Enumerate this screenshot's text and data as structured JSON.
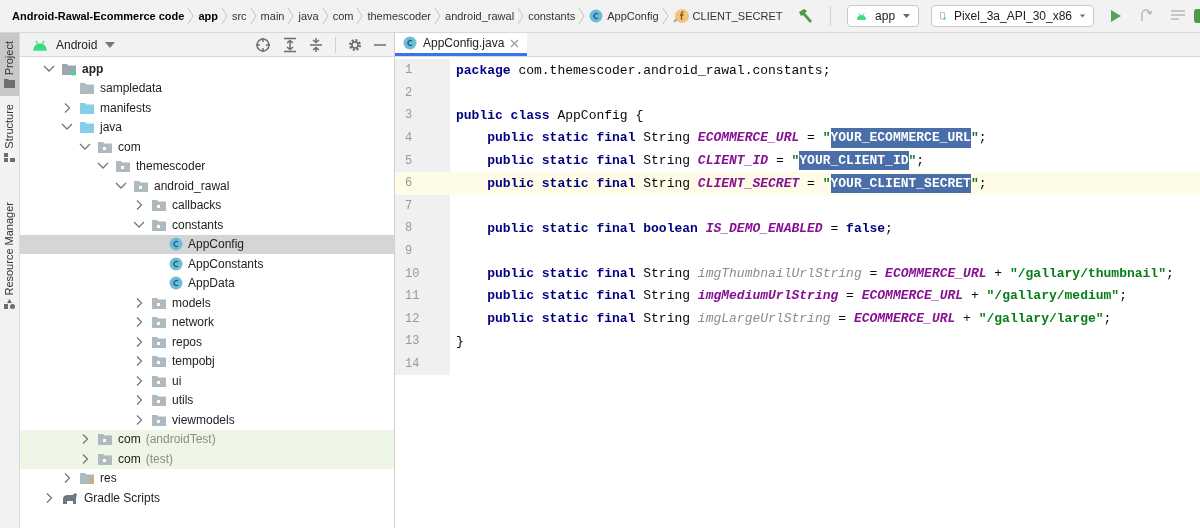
{
  "breadcrumbs": [
    {
      "label": "Android-Rawal-Ecommerce code",
      "kind": "project"
    },
    {
      "label": "app",
      "kind": "module"
    },
    {
      "label": "src",
      "kind": "folder"
    },
    {
      "label": "main",
      "kind": "folder"
    },
    {
      "label": "java",
      "kind": "folder"
    },
    {
      "label": "com",
      "kind": "folder"
    },
    {
      "label": "themescoder",
      "kind": "folder"
    },
    {
      "label": "android_rawal",
      "kind": "folder"
    },
    {
      "label": "constants",
      "kind": "folder"
    },
    {
      "label": "AppConfig",
      "kind": "class"
    },
    {
      "label": "CLIENT_SECRET",
      "kind": "field"
    }
  ],
  "run_config": {
    "module": "app",
    "device": "Pixel_3a_API_30_x86"
  },
  "tool_strip": [
    {
      "label": "Project",
      "selected": true
    },
    {
      "label": "Structure",
      "selected": false
    },
    {
      "label": "Resource Manager",
      "selected": false
    }
  ],
  "project_panel": {
    "view": "Android",
    "tree": [
      {
        "label": "app",
        "kind": "module",
        "expanded": true,
        "selected": false,
        "children": [
          {
            "label": "sampledata",
            "kind": "plain_folder",
            "selected": false
          },
          {
            "label": "manifests",
            "kind": "source_folder",
            "expanded": false,
            "selected": false
          },
          {
            "label": "java",
            "kind": "source_folder",
            "expanded": true,
            "selected": false,
            "children": [
              {
                "label": "com",
                "kind": "package",
                "expanded": true,
                "selected": false,
                "children": [
                  {
                    "label": "themescoder",
                    "kind": "package",
                    "expanded": true,
                    "selected": false,
                    "children": [
                      {
                        "label": "android_rawal",
                        "kind": "package",
                        "expanded": true,
                        "selected": false,
                        "children": [
                          {
                            "label": "callbacks",
                            "kind": "package",
                            "expanded": false,
                            "selected": false
                          },
                          {
                            "label": "constants",
                            "kind": "package",
                            "expanded": true,
                            "selected": false,
                            "children": [
                              {
                                "label": "AppConfig",
                                "kind": "class",
                                "selected": true
                              },
                              {
                                "label": "AppConstants",
                                "kind": "class",
                                "selected": false
                              },
                              {
                                "label": "AppData",
                                "kind": "class",
                                "selected": false
                              }
                            ]
                          },
                          {
                            "label": "models",
                            "kind": "package",
                            "expanded": false,
                            "selected": false
                          },
                          {
                            "label": "network",
                            "kind": "package",
                            "expanded": false,
                            "selected": false
                          },
                          {
                            "label": "repos",
                            "kind": "package",
                            "expanded": false,
                            "selected": false
                          },
                          {
                            "label": "tempobj",
                            "kind": "package",
                            "expanded": false,
                            "selected": false
                          },
                          {
                            "label": "ui",
                            "kind": "package",
                            "expanded": false,
                            "selected": false
                          },
                          {
                            "label": "utils",
                            "kind": "package",
                            "expanded": false,
                            "selected": false
                          },
                          {
                            "label": "viewmodels",
                            "kind": "package",
                            "expanded": false,
                            "selected": false
                          }
                        ]
                      }
                    ]
                  }
                ]
              },
              {
                "label": "com",
                "suffix": "(androidTest)",
                "kind": "test_package",
                "expanded": false,
                "selected": false
              },
              {
                "label": "com",
                "suffix": "(test)",
                "kind": "test_package",
                "expanded": false,
                "selected": false
              }
            ]
          },
          {
            "label": "res",
            "kind": "res_folder",
            "expanded": false,
            "selected": false
          }
        ]
      },
      {
        "label": "Gradle Scripts",
        "kind": "gradle",
        "expanded": false,
        "selected": false
      }
    ]
  },
  "editor": {
    "tabs": [
      {
        "label": "AppConfig.java",
        "selected": true
      }
    ],
    "lines": [
      {
        "number": "1",
        "current": false,
        "tokens": [
          {
            "kind": "kw",
            "text": "package"
          },
          {
            "kind": "txt",
            "text": " com.themescoder.android_rawal.constants;"
          }
        ]
      },
      {
        "number": "2",
        "current": false
      },
      {
        "number": "3",
        "current": false,
        "tokens": [
          {
            "kind": "kw",
            "text": "public class"
          },
          {
            "kind": "txt",
            "text": " AppConfig {"
          }
        ]
      },
      {
        "number": "4",
        "current": false,
        "tokens": [
          {
            "kind": "kw",
            "text": "    public static final"
          },
          {
            "kind": "txt",
            "text": " String "
          },
          {
            "kind": "const",
            "text": "ECOMMERCE_URL"
          },
          {
            "kind": "txt",
            "text": " = "
          },
          {
            "kind": "str",
            "text": "\""
          },
          {
            "kind": "sel",
            "text": "YOUR_ECOMMERCE_URL"
          },
          {
            "kind": "str",
            "text": "\""
          },
          {
            "kind": "txt",
            "text": ";"
          }
        ]
      },
      {
        "number": "5",
        "current": false,
        "tokens": [
          {
            "kind": "kw",
            "text": "    public static final"
          },
          {
            "kind": "txt",
            "text": " String "
          },
          {
            "kind": "const",
            "text": "CLIENT_ID"
          },
          {
            "kind": "txt",
            "text": " = "
          },
          {
            "kind": "str",
            "text": "\""
          },
          {
            "kind": "sel",
            "text": "YOUR_CLIENT_ID"
          },
          {
            "kind": "str",
            "text": "\""
          },
          {
            "kind": "txt",
            "text": ";"
          }
        ]
      },
      {
        "number": "6",
        "current": true,
        "tokens": [
          {
            "kind": "kw",
            "text": "    public static final"
          },
          {
            "kind": "txt",
            "text": " String "
          },
          {
            "kind": "const",
            "text": "CLIENT_SECRET"
          },
          {
            "kind": "txt",
            "text": " = "
          },
          {
            "kind": "str",
            "text": "\""
          },
          {
            "kind": "sel",
            "text": "YOUR_CLIENT_SECRET"
          },
          {
            "kind": "str",
            "text": "\""
          },
          {
            "kind": "txt",
            "text": ";"
          }
        ]
      },
      {
        "number": "7",
        "current": false
      },
      {
        "number": "8",
        "current": false,
        "tokens": [
          {
            "kind": "kw",
            "text": "    public static final boolean "
          },
          {
            "kind": "const",
            "text": "IS_DEMO_ENABLED"
          },
          {
            "kind": "txt",
            "text": " = "
          },
          {
            "kind": "kw",
            "text": "false"
          },
          {
            "kind": "txt",
            "text": ";"
          }
        ]
      },
      {
        "number": "9",
        "current": false
      },
      {
        "number": "10",
        "current": false,
        "tokens": [
          {
            "kind": "kw",
            "text": "    public static final"
          },
          {
            "kind": "txt",
            "text": " String "
          },
          {
            "kind": "unused",
            "text": "imgThumbnailUrlString"
          },
          {
            "kind": "txt",
            "text": " = "
          },
          {
            "kind": "const",
            "text": "ECOMMERCE_URL"
          },
          {
            "kind": "txt",
            "text": " + "
          },
          {
            "kind": "str",
            "text": "\"/gallary/thumbnail\""
          },
          {
            "kind": "txt",
            "text": ";"
          }
        ]
      },
      {
        "number": "11",
        "current": false,
        "tokens": [
          {
            "kind": "kw",
            "text": "    public static final"
          },
          {
            "kind": "txt",
            "text": " String "
          },
          {
            "kind": "const",
            "text": "imgMediumUrlString"
          },
          {
            "kind": "txt",
            "text": " = "
          },
          {
            "kind": "const",
            "text": "ECOMMERCE_URL"
          },
          {
            "kind": "txt",
            "text": " + "
          },
          {
            "kind": "str",
            "text": "\"/gallary/medium\""
          },
          {
            "kind": "txt",
            "text": ";"
          }
        ]
      },
      {
        "number": "12",
        "current": false,
        "tokens": [
          {
            "kind": "kw",
            "text": "    public static final"
          },
          {
            "kind": "txt",
            "text": " String "
          },
          {
            "kind": "unused",
            "text": "imgLargeUrlString"
          },
          {
            "kind": "txt",
            "text": " = "
          },
          {
            "kind": "const",
            "text": "ECOMMERCE_URL"
          },
          {
            "kind": "txt",
            "text": " + "
          },
          {
            "kind": "str",
            "text": "\"/gallary/large\""
          },
          {
            "kind": "txt",
            "text": ";"
          }
        ]
      },
      {
        "number": "13",
        "current": false,
        "tokens": [
          {
            "kind": "txt",
            "text": "}"
          }
        ]
      },
      {
        "number": "14",
        "current": false
      }
    ]
  }
}
